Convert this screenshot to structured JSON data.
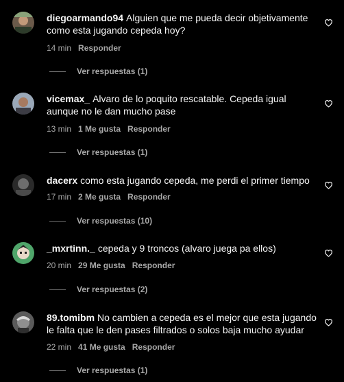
{
  "colors": {
    "background": "#000000",
    "text": "#f5f5f5",
    "muted": "#a8a8a8"
  },
  "comments": [
    {
      "username": "diegoarmando94",
      "text": "Alguien que me pueda decir objetivamente como esta jugando cepeda hoy?",
      "time": "14 min",
      "likes": "",
      "reply_label": "Responder",
      "replies_label": "Ver respuestas (1)",
      "avatar_icon": "avatar-photo"
    },
    {
      "username": "vicemax_",
      "text": "Alvaro de lo poquito rescatable. Cepeda igual aunque no le dan mucho pase",
      "time": "13 min",
      "likes": "1 Me gusta",
      "reply_label": "Responder",
      "replies_label": "Ver respuestas (1)",
      "avatar_icon": "avatar-photo"
    },
    {
      "username": "dacerx",
      "text": "como esta jugando cepeda, me perdi el primer tiempo",
      "time": "17 min",
      "likes": "2 Me gusta",
      "reply_label": "Responder",
      "replies_label": "Ver respuestas (10)",
      "avatar_icon": "avatar-photo"
    },
    {
      "username": "_mxrtinn._",
      "text": "cepeda y 9 troncos (alvaro juega pa ellos)",
      "time": "20 min",
      "likes": "29 Me gusta",
      "reply_label": "Responder",
      "replies_label": "Ver respuestas (2)",
      "avatar_icon": "avatar-photo"
    },
    {
      "username": "89.tomibm",
      "text": "No cambien a cepeda es el mejor que esta jugando le falta que le den pases filtrados o solos baja mucho ayudar",
      "time": "22 min",
      "likes": "41 Me gusta",
      "reply_label": "Responder",
      "replies_label": "Ver respuestas (1)",
      "avatar_icon": "avatar-photo"
    }
  ]
}
